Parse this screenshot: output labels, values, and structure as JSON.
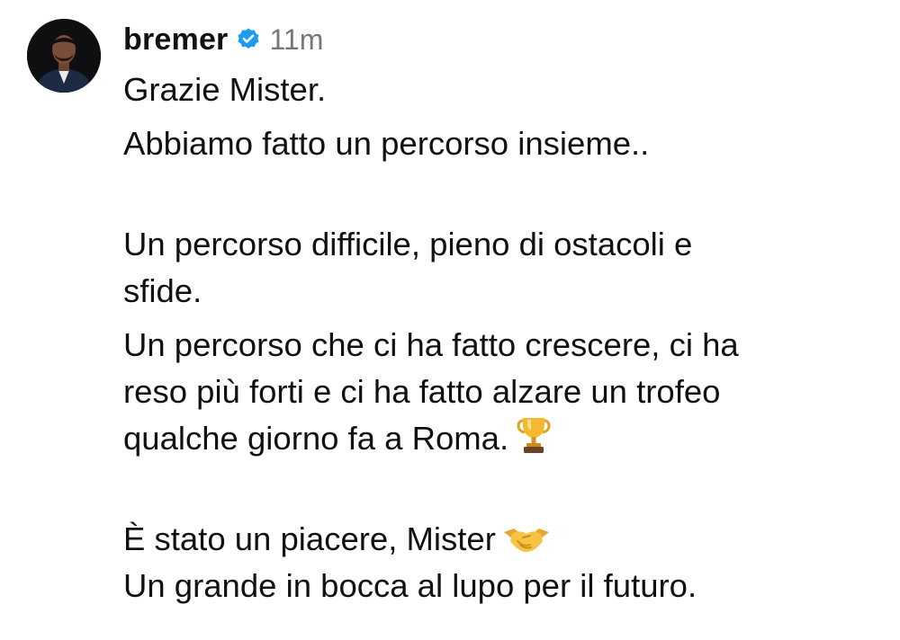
{
  "post": {
    "username": "bremer",
    "verified_icon": "verified-badge-icon",
    "verified_color": "#1d9bf0",
    "timestamp": "11m",
    "avatar_icon": "profile-avatar",
    "caption": {
      "line1": "Grazie Mister.",
      "line2": "Abbiamo fatto un percorso insieme..",
      "line3": "Un percorso difficile, pieno di ostacoli e",
      "line4": "sfide.",
      "line5": "Un percorso che ci ha fatto crescere, ci ha",
      "line6": "reso più forti e ci ha fatto alzare un trofeo",
      "line7": "qualche giorno fa a Roma.",
      "line7_emoji": "trophy-icon",
      "line8": "È stato un piacere, Mister",
      "line8_emoji": "handshake-icon",
      "line9": "Un grande in bocca al lupo per il futuro."
    }
  }
}
